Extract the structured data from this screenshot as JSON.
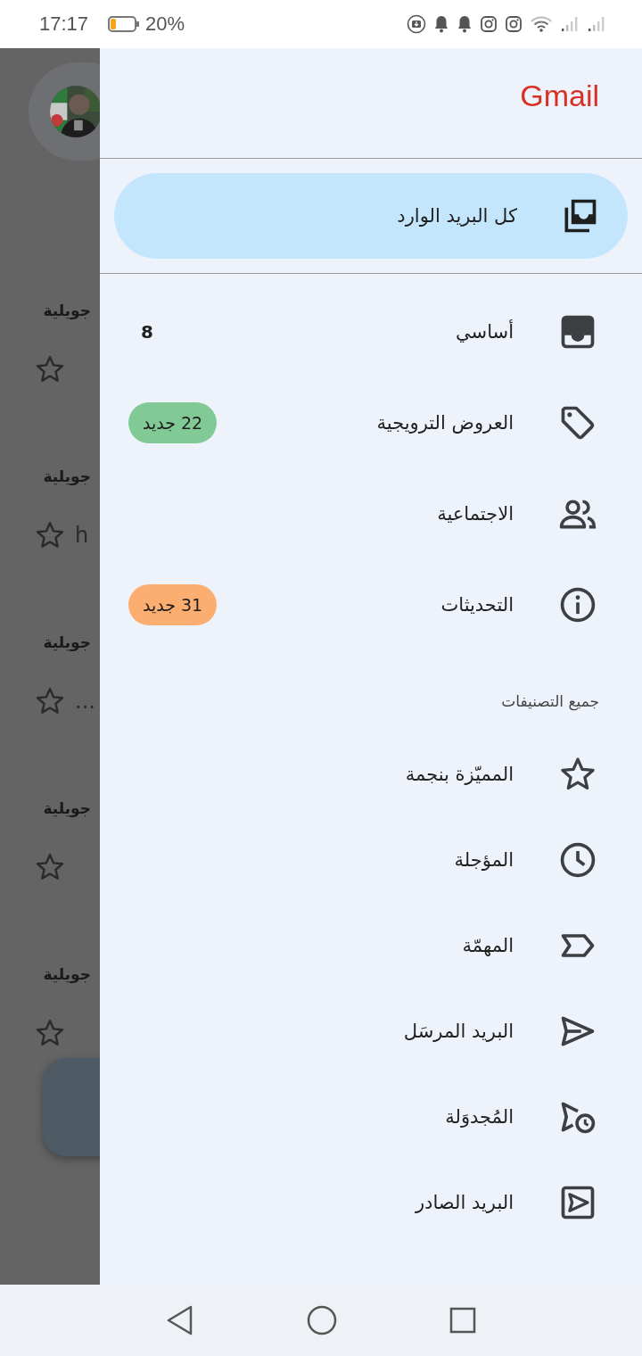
{
  "status_bar": {
    "time": "17:17",
    "battery": "20%"
  },
  "background_list": {
    "rows": [
      {
        "date": "جويلية"
      },
      {
        "date": "جويلية",
        "snippet": "h"
      },
      {
        "date": "جويلية",
        "snippet": "..."
      },
      {
        "date": "جويلية"
      },
      {
        "date": "جويلية"
      }
    ]
  },
  "drawer": {
    "title": "Gmail",
    "top_items": [
      {
        "label": "كل البريد الوارد",
        "selected": true
      }
    ],
    "categories": [
      {
        "label": "أساسي",
        "selected": false,
        "count": "8"
      },
      {
        "label": "العروض الترويجية",
        "selected": false,
        "badge": "22 جديد",
        "color": "#81c995"
      },
      {
        "label": "الاجتماعية",
        "selected": false
      },
      {
        "label": "التحديثات",
        "selected": false,
        "badge": "31 جديد",
        "color": "#fcad70"
      }
    ],
    "section": "جميع التصنيفات",
    "labels": [
      {
        "label": "المميّزة بنجمة",
        "selected": false
      },
      {
        "label": "المؤجلة",
        "selected": false
      },
      {
        "label": "المهمّة",
        "selected": false
      },
      {
        "label": "البريد المرسَل",
        "selected": false
      },
      {
        "label": "المُجدوَلة",
        "selected": false
      },
      {
        "label": "البريد الصادر",
        "selected": false
      }
    ]
  }
}
